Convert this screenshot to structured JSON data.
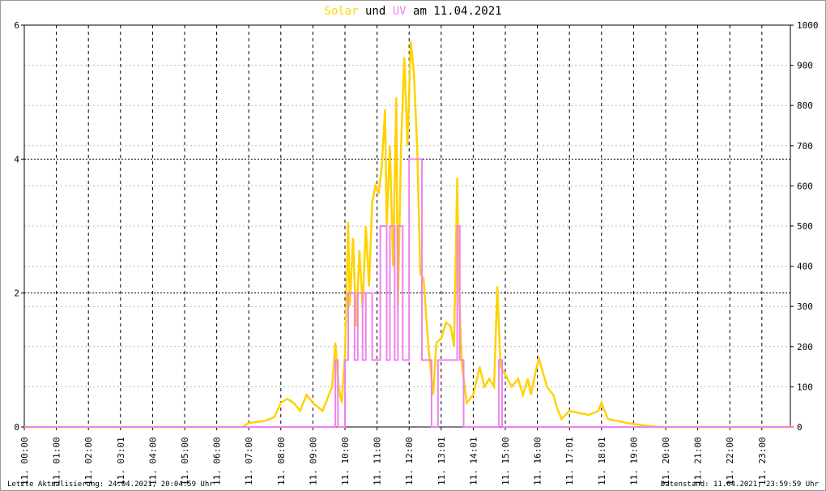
{
  "title": {
    "solar": "Solar",
    "und": "und",
    "uv": "UV",
    "date": "am 11.04.2021"
  },
  "footer": {
    "left": "Letzte Aktualisierung: 24.04.2021, 20:04:59 Uhr",
    "right": "Datenstand: 11.04.2021, 23:59:59 Uhr"
  },
  "colors": {
    "solar": "#ffd200",
    "uv": "#ee82ee"
  },
  "chart_data": {
    "type": "line",
    "title": "Solar und UV am 11.04.2021",
    "x_unit": "hour",
    "xlim": [
      0,
      24
    ],
    "y_left": {
      "label": "UV",
      "ylim": [
        0,
        6
      ],
      "ticks": [
        "0",
        "2",
        "4",
        "6"
      ]
    },
    "y_right": {
      "label": "Solar",
      "ylim": [
        0,
        1000
      ],
      "ticks": [
        "0",
        "100",
        "200",
        "300",
        "400",
        "500",
        "600",
        "700",
        "800",
        "900",
        "1000"
      ]
    },
    "x_ticks": [
      "11. 00:00",
      "11. 01:00",
      "11. 02:00",
      "11. 03:01",
      "11. 04:00",
      "11. 05:00",
      "11. 06:00",
      "11. 07:00",
      "11. 08:00",
      "11. 09:00",
      "11. 10:00",
      "11. 11:00",
      "11. 12:00",
      "11. 13:01",
      "11. 14:01",
      "11. 15:00",
      "11. 16:00",
      "11. 17:01",
      "11. 18:01",
      "11. 19:00",
      "11. 20:00",
      "11. 21:00",
      "11. 22:00",
      "11. 23:00"
    ],
    "grid": true,
    "series": [
      {
        "name": "Solar",
        "axis": "right",
        "x": [
          0,
          6.8,
          7.0,
          7.5,
          7.8,
          8.0,
          8.2,
          8.4,
          8.6,
          8.8,
          9.0,
          9.3,
          9.5,
          9.6,
          9.7,
          9.8,
          9.9,
          10.0,
          10.1,
          10.15,
          10.25,
          10.35,
          10.45,
          10.55,
          10.65,
          10.75,
          10.85,
          10.95,
          11.05,
          11.15,
          11.25,
          11.3,
          11.4,
          11.5,
          11.6,
          11.65,
          11.75,
          11.85,
          11.95,
          12.05,
          12.15,
          12.25,
          12.35,
          12.45,
          12.6,
          12.75,
          12.85,
          13.0,
          13.15,
          13.3,
          13.4,
          13.5,
          13.55,
          13.65,
          13.8,
          14.0,
          14.2,
          14.35,
          14.5,
          14.65,
          14.75,
          14.85,
          15.0,
          15.2,
          15.4,
          15.55,
          15.7,
          15.8,
          15.95,
          16.05,
          16.3,
          16.5,
          16.6,
          16.75,
          17.0,
          17.3,
          17.6,
          17.9,
          18.0,
          18.2,
          18.5,
          18.8,
          19.2,
          19.8,
          24
        ],
        "values": [
          0,
          0,
          10,
          15,
          25,
          60,
          70,
          60,
          40,
          80,
          60,
          40,
          80,
          100,
          210,
          100,
          60,
          180,
          510,
          300,
          470,
          250,
          440,
          300,
          500,
          350,
          560,
          600,
          580,
          650,
          790,
          500,
          700,
          400,
          820,
          300,
          700,
          920,
          700,
          960,
          880,
          700,
          380,
          370,
          200,
          80,
          210,
          220,
          260,
          250,
          200,
          620,
          350,
          150,
          60,
          80,
          150,
          100,
          120,
          100,
          350,
          150,
          130,
          100,
          120,
          80,
          120,
          80,
          140,
          170,
          100,
          80,
          50,
          20,
          40,
          35,
          30,
          40,
          60,
          20,
          15,
          10,
          5,
          0,
          0
        ]
      },
      {
        "name": "UV",
        "axis": "left",
        "step": true,
        "x": [
          0,
          9.7,
          9.78,
          10.0,
          10.1,
          10.3,
          10.4,
          10.55,
          10.65,
          10.85,
          11.1,
          11.3,
          11.4,
          11.55,
          11.65,
          11.8,
          12.0,
          12.4,
          12.7,
          12.9,
          13.5,
          13.58,
          13.7,
          14.8,
          14.9,
          24
        ],
        "values": [
          0,
          1,
          0,
          1,
          2,
          1,
          2,
          1,
          2,
          1,
          3,
          1,
          3,
          1,
          3,
          1,
          4,
          1,
          0,
          1,
          3,
          1,
          0,
          1,
          0,
          0
        ]
      }
    ]
  }
}
